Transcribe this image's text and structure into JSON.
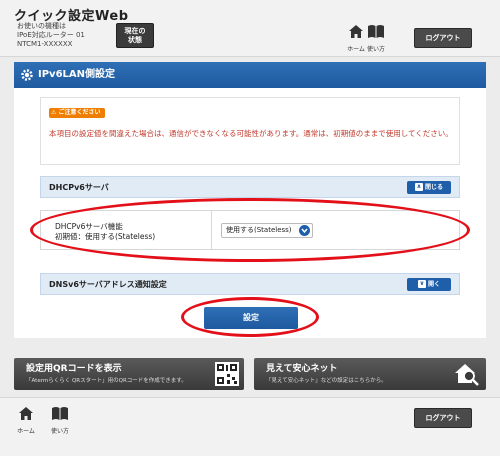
{
  "header": {
    "app_title": "クイック設定Web",
    "device_lines": [
      "お使いの機種は",
      "IPoE対応ルーター 01",
      "NTCM1-XXXXXX"
    ],
    "status_button": [
      "現在の",
      "状態"
    ],
    "home_label": "ホーム",
    "manual_label": "使い方",
    "logout_label": "ログアウト"
  },
  "page": {
    "title": "IPv6LAN側設定"
  },
  "notice": {
    "badge": "ご注意ください",
    "text": "本項目の設定値を間違えた場合は、通信ができなくなる可能性があります。通常は、初期値のままで使用してください。"
  },
  "dhcp_section": {
    "title": "DHCPv6サーバ",
    "toggle_label": "閉じる",
    "setting_label": "DHCPv6サーバ機能",
    "setting_default": "初期値：使用する(Stateless)",
    "select_value": "使用する(Stateless)"
  },
  "dns_section": {
    "title": "DNSv6サーバアドレス通知設定",
    "toggle_label": "開く"
  },
  "submit_label": "設定",
  "banners": {
    "qr_title": "設定用QRコードを表示",
    "qr_sub": "「Atermらくらく QRスタート」用のQRコードを作成できます。",
    "safe_title": "見えて安心ネット",
    "safe_sub": "「見えて安心ネット」などの設定はこちらから。"
  },
  "footer": {
    "home_label": "ホーム",
    "manual_label": "使い方",
    "logout_label": "ログアウト"
  },
  "colors": {
    "primary": "#1f5ea8",
    "warning": "#ee7d00",
    "warning_text": "#c0392b",
    "annotation": "#e3101a"
  }
}
